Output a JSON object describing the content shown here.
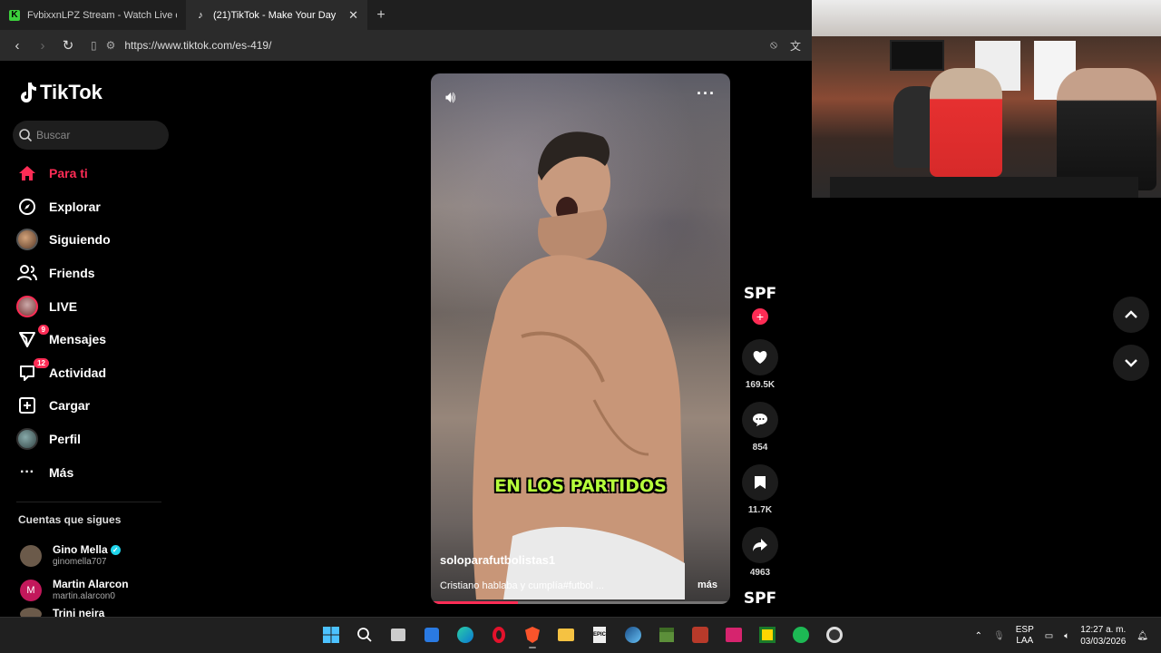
{
  "browser": {
    "tabs": [
      {
        "title": "FvbixxnLPZ Stream - Watch Live on K",
        "active": false
      },
      {
        "title": "(21)TikTok - Make Your Day",
        "active": true
      }
    ],
    "url": "https://www.tiktok.com/es-419/"
  },
  "tiktok": {
    "logo": "TikTok",
    "search_placeholder": "Buscar",
    "nav": [
      {
        "label": "Para ti",
        "icon": "home-icon",
        "active": true
      },
      {
        "label": "Explorar",
        "icon": "compass-icon"
      },
      {
        "label": "Siguiendo",
        "icon": "avatar-icon"
      },
      {
        "label": "Friends",
        "icon": "friends-icon"
      },
      {
        "label": "LIVE",
        "icon": "live-icon"
      },
      {
        "label": "Mensajes",
        "icon": "messages-icon",
        "badge": "9"
      },
      {
        "label": "Actividad",
        "icon": "activity-icon",
        "badge": "12"
      },
      {
        "label": "Cargar",
        "icon": "upload-icon"
      },
      {
        "label": "Perfil",
        "icon": "profile-icon"
      },
      {
        "label": "Más",
        "icon": "more-icon"
      }
    ],
    "following_title": "Cuentas que sigues",
    "following": [
      {
        "name": "Gino Mella",
        "handle": "ginomella707",
        "verified": true
      },
      {
        "name": "Martin Alarcon",
        "handle": "martin.alarcon0",
        "initial": "M"
      },
      {
        "name": "Trini neira",
        "handle": ""
      }
    ]
  },
  "video": {
    "caption_overlay": "EN LOS PARTIDOS",
    "author": "soloparafutbolistas1",
    "description": "Cristiano hablaba y cumplía#futbol ...",
    "more_label": "más",
    "progress": 0.29
  },
  "actions": {
    "creator_badge": "SPF",
    "likes": "169.5K",
    "comments": "854",
    "saves": "11.7K",
    "shares": "4963",
    "next_badge": "SPF"
  },
  "taskbar": {
    "lang_top": "ESP",
    "lang_bottom": "LAA",
    "time": "12:27 a. m.",
    "date": "03/03/2026"
  }
}
